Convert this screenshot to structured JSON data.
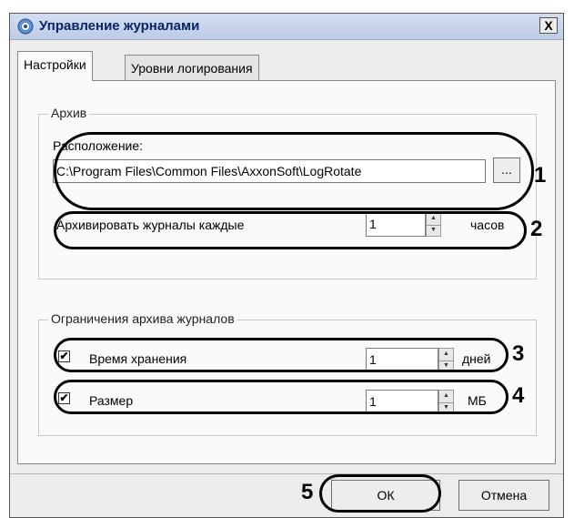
{
  "window": {
    "title": "Управление журналами",
    "close_label": "X"
  },
  "tabs": [
    {
      "label": "Настройки",
      "active": true
    },
    {
      "label": "Уровни логирования",
      "active": false
    }
  ],
  "archive": {
    "group_label": "Архив",
    "location_label": "Расположение:",
    "location_value": "C:\\Program Files\\Common Files\\AxxonSoft\\LogRotate",
    "browse_label": "...",
    "interval_label": "Архивировать журналы каждые",
    "interval_value": "1",
    "interval_unit": "часов"
  },
  "limits": {
    "group_label": "Ограничения архива журналов",
    "retention": {
      "label": "Время хранения",
      "checked": true,
      "value": "1",
      "unit": "дней"
    },
    "size": {
      "label": "Размер",
      "checked": true,
      "value": "1",
      "unit": "МБ"
    }
  },
  "buttons": {
    "ok": "ОК",
    "cancel": "Отмена"
  },
  "markers": [
    "1",
    "2",
    "3",
    "4",
    "5"
  ],
  "icons": {
    "checkmark": "✔",
    "spin_up": "▲",
    "spin_down": "▼"
  }
}
